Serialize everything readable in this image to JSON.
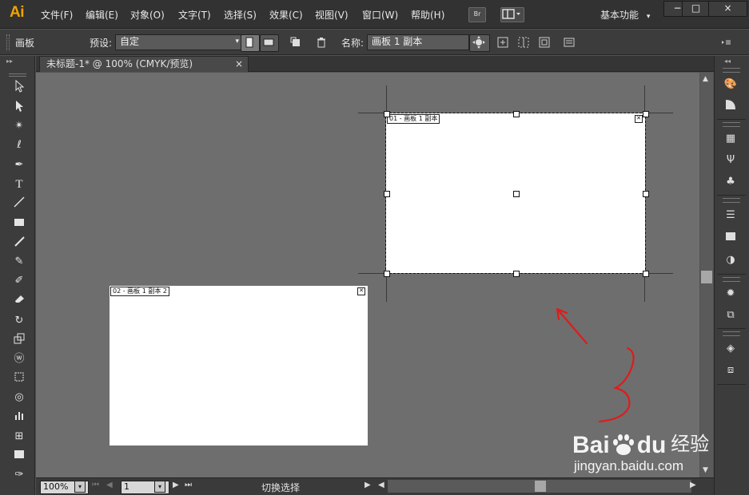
{
  "app": {
    "logo": "Ai"
  },
  "menubar": {
    "items": [
      "文件(F)",
      "编辑(E)",
      "对象(O)",
      "文字(T)",
      "选择(S)",
      "效果(C)",
      "视图(V)",
      "窗口(W)",
      "帮助(H)"
    ],
    "bridge_label": "Br",
    "workspace_label": "基本功能",
    "min_label": "−",
    "max_label": "□",
    "close_label": "×"
  },
  "controlbar": {
    "title": "画板",
    "preset_label": "预设:",
    "preset_value": "自定",
    "name_label": "名称:",
    "name_value": "画板 1 副本"
  },
  "document": {
    "tab_title": "未标题-1* @ 100% (CMYK/预览)",
    "tab_close": "×"
  },
  "artboards": [
    {
      "label": "01 - 画板 1 副本",
      "selected": true
    },
    {
      "label": "02 - 画板 1 副本 2",
      "selected": false
    }
  ],
  "statusbar": {
    "zoom": "100%",
    "page": "1",
    "status_text": "切换选择"
  },
  "annotation": {
    "color": "#e01b1b"
  },
  "watermark": {
    "brand": "Bai",
    "brand2": "du",
    "site": "经验",
    "url": "jingyan.baidu.com"
  }
}
